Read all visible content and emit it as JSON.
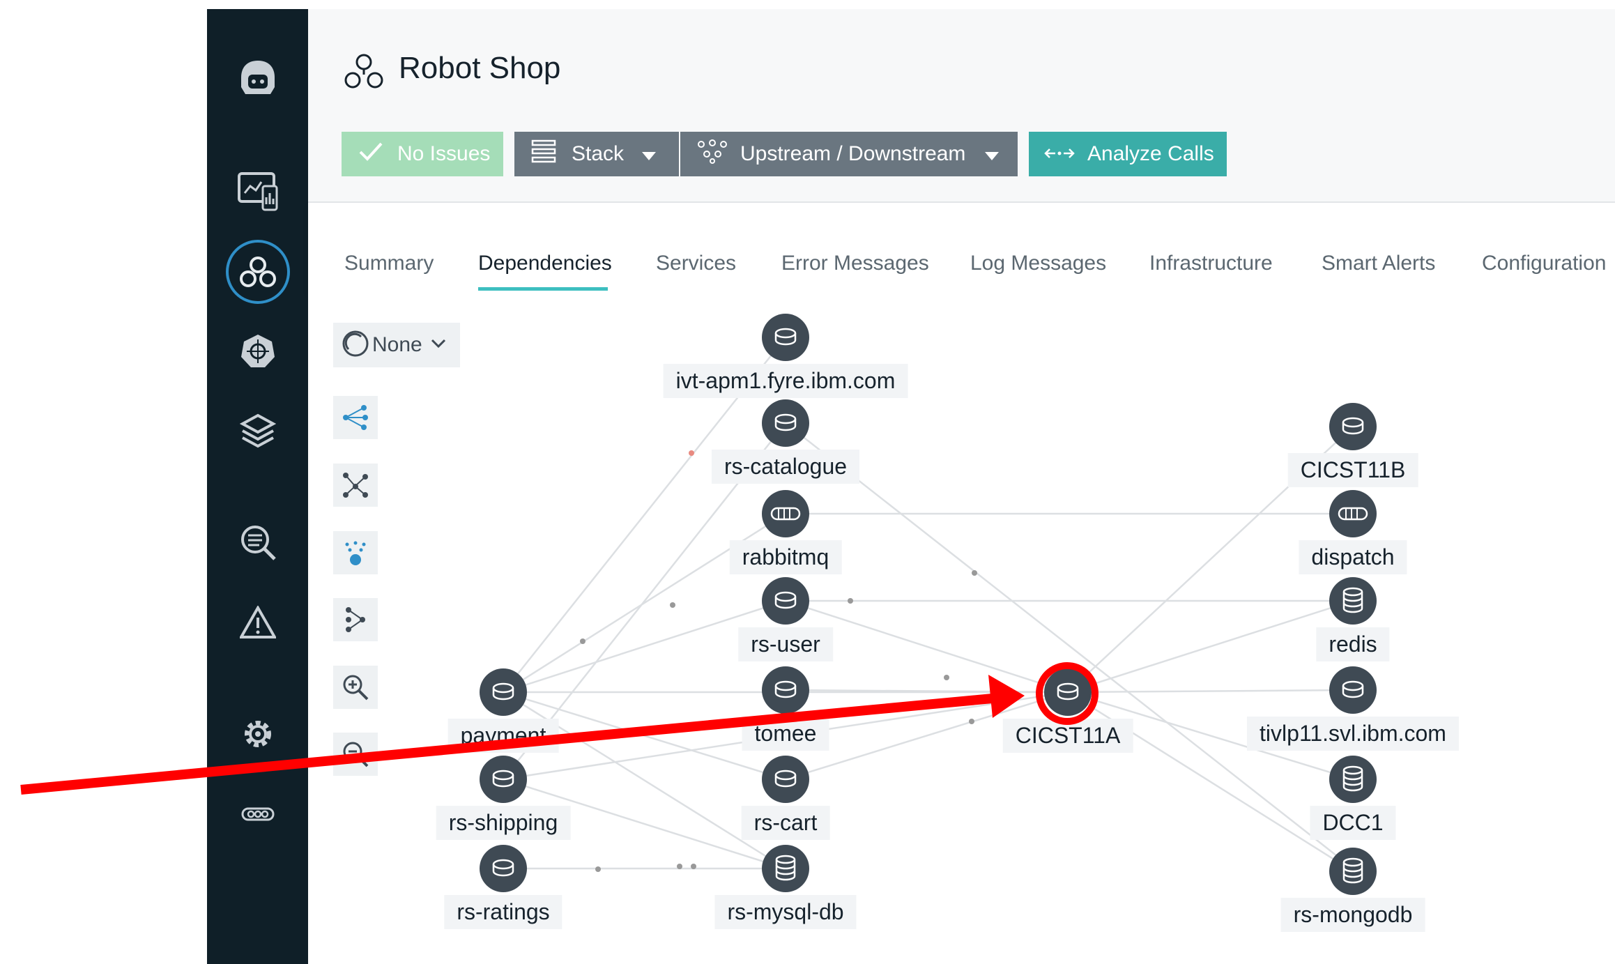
{
  "app": {
    "title": "Robot Shop"
  },
  "toolbar": {
    "issues_label": "No Issues",
    "stack_label": "Stack",
    "updown_label": "Upstream / Downstream",
    "analyze_label": "Analyze Calls"
  },
  "tabs": [
    {
      "label": "Summary"
    },
    {
      "label": "Dependencies"
    },
    {
      "label": "Services"
    },
    {
      "label": "Error Messages"
    },
    {
      "label": "Log Messages"
    },
    {
      "label": "Infrastructure"
    },
    {
      "label": "Smart Alerts"
    },
    {
      "label": "Configuration"
    }
  ],
  "active_tab": "Dependencies",
  "filter": {
    "label": "None"
  },
  "nodes": [
    {
      "label": "ivt-apm1.fyre.ibm.com",
      "icon": "database-icon"
    },
    {
      "label": "rs-catalogue",
      "icon": "database-icon"
    },
    {
      "label": "rabbitmq",
      "icon": "queue-icon"
    },
    {
      "label": "rs-user",
      "icon": "database-icon"
    },
    {
      "label": "tomee",
      "icon": "database-icon"
    },
    {
      "label": "rs-cart",
      "icon": "database-icon"
    },
    {
      "label": "rs-mysql-db",
      "icon": "database-stack-icon"
    },
    {
      "label": "payment",
      "icon": "database-icon"
    },
    {
      "label": "rs-shipping",
      "icon": "database-icon"
    },
    {
      "label": "rs-ratings",
      "icon": "database-icon"
    },
    {
      "label": "CICST11A",
      "icon": "database-icon"
    },
    {
      "label": "CICST11B",
      "icon": "database-icon"
    },
    {
      "label": "dispatch",
      "icon": "queue-icon"
    },
    {
      "label": "redis",
      "icon": "database-stack-icon"
    },
    {
      "label": "tivlp11.svl.ibm.com",
      "icon": "database-icon"
    },
    {
      "label": "DCC1",
      "icon": "database-stack-icon"
    },
    {
      "label": "rs-mongodb",
      "icon": "database-stack-icon"
    }
  ],
  "colors": {
    "sidebar": "#0f1f28",
    "no_issues_green": "#a5ddb8",
    "stack_button": "#6a7680",
    "analyze_teal": "#3aada8",
    "tab_underline": "#3dbfc0",
    "annotation_red": "#ff0000",
    "node_fill": "#3f4a54"
  }
}
